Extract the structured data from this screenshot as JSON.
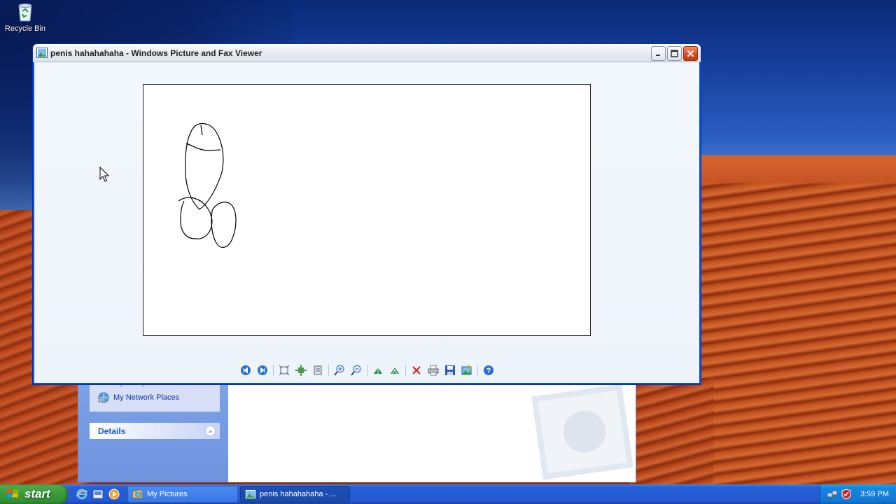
{
  "desktop": {
    "icons": [
      {
        "label": "Recycle Bin",
        "icon": "recycle-bin-icon"
      }
    ]
  },
  "viewer": {
    "title": "penis hahahahaha - Windows Picture and Fax Viewer",
    "toolbar": [
      "previous-image-icon",
      "next-image-icon",
      "best-fit-icon",
      "actual-size-icon",
      "slideshow-icon",
      "zoom-in-icon",
      "zoom-out-icon",
      "rotate-clockwise-icon",
      "rotate-counterclockwise-icon",
      "delete-icon",
      "print-icon",
      "save-icon",
      "open-editor-icon",
      "help-icon"
    ]
  },
  "explorer": {
    "places": [
      "My Computer",
      "My Network Places"
    ],
    "details_title": "Details"
  },
  "taskbar": {
    "start_label": "start",
    "tasks": [
      {
        "label": "My Pictures",
        "icon": "folder-icon",
        "active": false
      },
      {
        "label": "penis hahahahaha - ...",
        "icon": "picture-viewer-icon",
        "active": true
      }
    ],
    "clock": "3:59 PM"
  },
  "colors": {
    "taskbar_blue": "#2458d0",
    "start_green": "#3c9a3c",
    "close_red": "#d44a22",
    "tray_blue": "#1486e0"
  }
}
